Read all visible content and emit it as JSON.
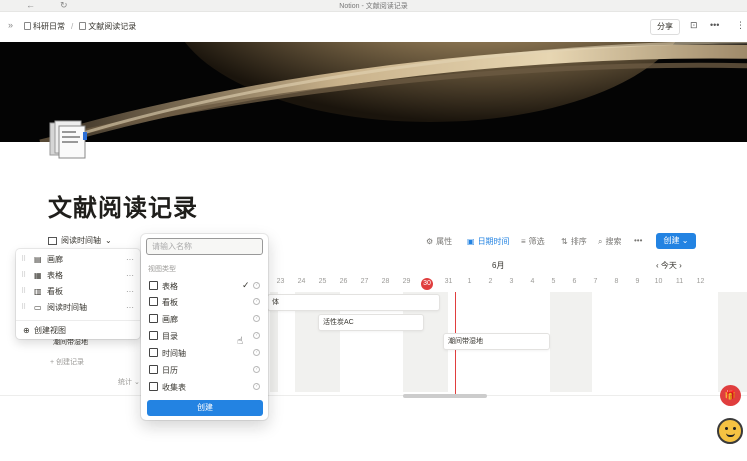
{
  "window": {
    "title": "Notion - 文献阅读记录"
  },
  "breadcrumb": [
    {
      "label": "科研日常"
    },
    {
      "label": "文献阅读记录"
    }
  ],
  "header": {
    "share_label": "分享",
    "more_label": "•••"
  },
  "page": {
    "title": "文献阅读记录"
  },
  "toolbar": {
    "current_view": "阅读时间轴",
    "properties": "属性",
    "date": "日期时间",
    "filter": "筛选",
    "sort": "排序",
    "search": "搜索",
    "more": "•••",
    "new_label": "创建"
  },
  "timeline": {
    "month": "6月",
    "today_label": "今天",
    "days": [
      "23",
      "24",
      "25",
      "26",
      "27",
      "28",
      "29",
      "30",
      "31",
      "1",
      "2",
      "3",
      "4",
      "5",
      "6",
      "7",
      "8",
      "9",
      "10",
      "11",
      "12"
    ],
    "today_day": "30",
    "bars": [
      {
        "label": "体"
      },
      {
        "label": "活性炭AC"
      },
      {
        "label": "潮间带湿地"
      }
    ]
  },
  "left_rows": {
    "row_label": "潮间带湿地",
    "new_record": "+ 创建记录",
    "count_label": "统计 ⌄"
  },
  "views_popup": {
    "items": [
      {
        "icon": "board-icon",
        "label": "画廊"
      },
      {
        "icon": "table-icon",
        "label": "表格"
      },
      {
        "icon": "board-icon",
        "label": "看板"
      },
      {
        "icon": "timeline-icon",
        "label": "阅读时间轴"
      }
    ],
    "add_label": "创建视图"
  },
  "add_view_popup": {
    "placeholder": "请输入名称",
    "section_label": "视图类型",
    "types": [
      {
        "label": "表格",
        "selected": true
      },
      {
        "label": "看板",
        "selected": false
      },
      {
        "label": "画廊",
        "selected": false
      },
      {
        "label": "目录",
        "selected": false
      },
      {
        "label": "时间轴",
        "selected": false
      },
      {
        "label": "日历",
        "selected": false
      },
      {
        "label": "收集表",
        "selected": false
      }
    ],
    "create_label": "创建"
  }
}
